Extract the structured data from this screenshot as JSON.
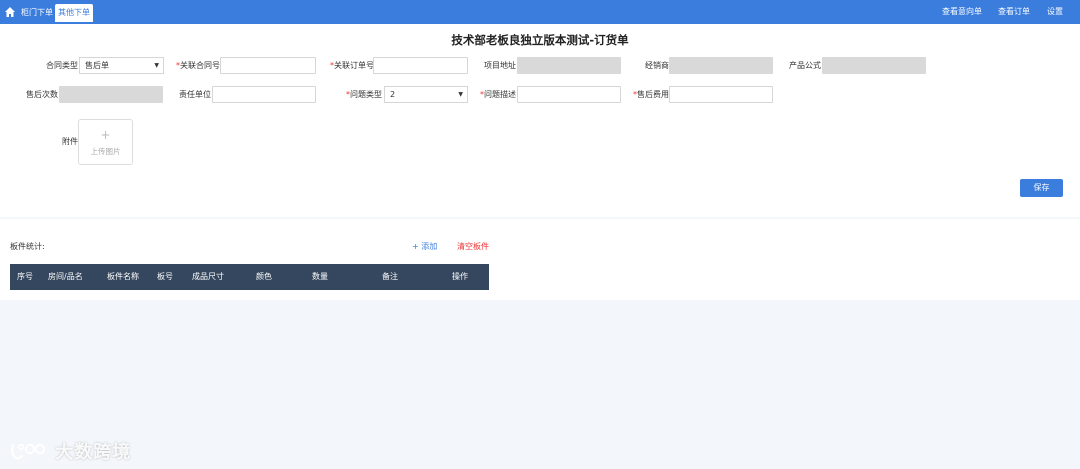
{
  "nav": {
    "tabs": [
      {
        "label": "柜门下单",
        "active": false
      },
      {
        "label": "其他下单",
        "active": true
      }
    ],
    "right_links": [
      "查看意向单",
      "查看订单",
      "设置"
    ]
  },
  "form": {
    "title": "技术部老板良独立版本测试-订货单",
    "row1": {
      "contract_type_label": "合同类型",
      "contract_type_value": "售后单",
      "related_contract_label": "关联合同号",
      "related_order_label": "关联订单号",
      "project_address_label": "项目地址",
      "dealer_label": "经销商",
      "product_formula_label": "产品公式"
    },
    "row2": {
      "aftersale_count_label": "售后次数",
      "responsible_unit_label": "责任单位",
      "issue_type_label": "问题类型",
      "issue_type_value": "2",
      "issue_desc_label": "问题描述",
      "aftersale_cost_label": "售后费用"
    },
    "attachment_label": "附件",
    "upload_plus": "+",
    "upload_label": "上传图片",
    "save_label": "保存"
  },
  "panel": {
    "stat_label": "板件统计:",
    "add_label": "+ 添加",
    "clear_label": "清空板件",
    "columns": [
      "序号",
      "房间/品名",
      "板件名称",
      "板号",
      "成品尺寸",
      "颜色",
      "数量",
      "备注",
      "操作"
    ]
  },
  "watermark": {
    "text": "大数跨境"
  },
  "colors": {
    "primary": "#3b7ddd",
    "table_header": "#35475e",
    "required": "#e33333",
    "disabled_field": "#d9d9d9"
  }
}
